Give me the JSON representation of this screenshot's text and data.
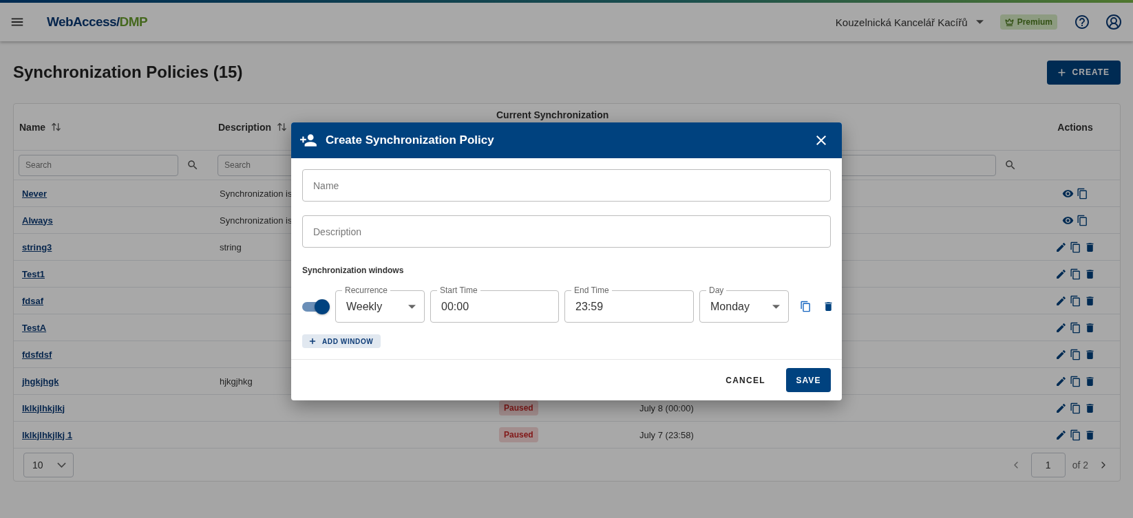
{
  "header": {
    "logo": {
      "primary": "WebAccess/",
      "accent": "DMP"
    },
    "organization": "Kouzelnická Kancelář Kacířů",
    "badge": "Premium"
  },
  "page": {
    "title": "Synchronization Policies (15)",
    "create_button": "CREATE"
  },
  "table": {
    "columns": [
      {
        "label": "Name",
        "sortable": true,
        "filter": {
          "kind": "search",
          "placeholder": "Search"
        }
      },
      {
        "label": "Description",
        "sortable": true,
        "filter": {
          "kind": "field",
          "placeholder": "Search"
        }
      },
      {
        "label": "Current Synchronization",
        "filter": {
          "kind": "none"
        }
      },
      {
        "filter": {
          "kind": "search"
        }
      },
      {
        "label": "Actions",
        "filter": {
          "kind": "none"
        }
      }
    ],
    "rows": [
      {
        "kind": "view",
        "name": "Never",
        "description": "Synchronization is"
      },
      {
        "kind": "view",
        "name": "Always",
        "description": "Synchronization is"
      },
      {
        "kind": "edit",
        "name": "string3",
        "description": "string"
      },
      {
        "kind": "edit",
        "name": "Test1"
      },
      {
        "kind": "edit",
        "name": "fdsaf"
      },
      {
        "kind": "edit",
        "name": "TestA"
      },
      {
        "kind": "edit",
        "name": "fdsfdsf"
      },
      {
        "kind": "edit",
        "name": "jhgkjhgk",
        "description": "hjkgjhkg"
      },
      {
        "kind": "edit",
        "name": "lklkjlhkjlkj",
        "status": "Paused",
        "next": "July 8 (00:00)"
      },
      {
        "kind": "edit",
        "name": "lklkjlhkjlkj 1",
        "status": "Paused",
        "next": "July 7 (23:58)"
      }
    ],
    "page_size": "10",
    "page": "1",
    "page_count": "of 2"
  },
  "dialog": {
    "title": "Create Synchronization Policy",
    "name_field": {
      "placeholder": "Name"
    },
    "description_field": {
      "placeholder": "Description"
    },
    "windows_label": "Synchronization windows",
    "windows": [
      {
        "on": true,
        "recurrence": {
          "label": "Recurrence",
          "value": "Weekly"
        },
        "start": {
          "label": "Start Time",
          "value": "00:00"
        },
        "end": {
          "label": "End Time",
          "value": "23:59"
        },
        "day": {
          "label": "Day",
          "value": "Monday"
        }
      }
    ],
    "add_button": "ADD WINDOW",
    "cancel_button": "CANCEL",
    "save_button": "SAVE"
  }
}
